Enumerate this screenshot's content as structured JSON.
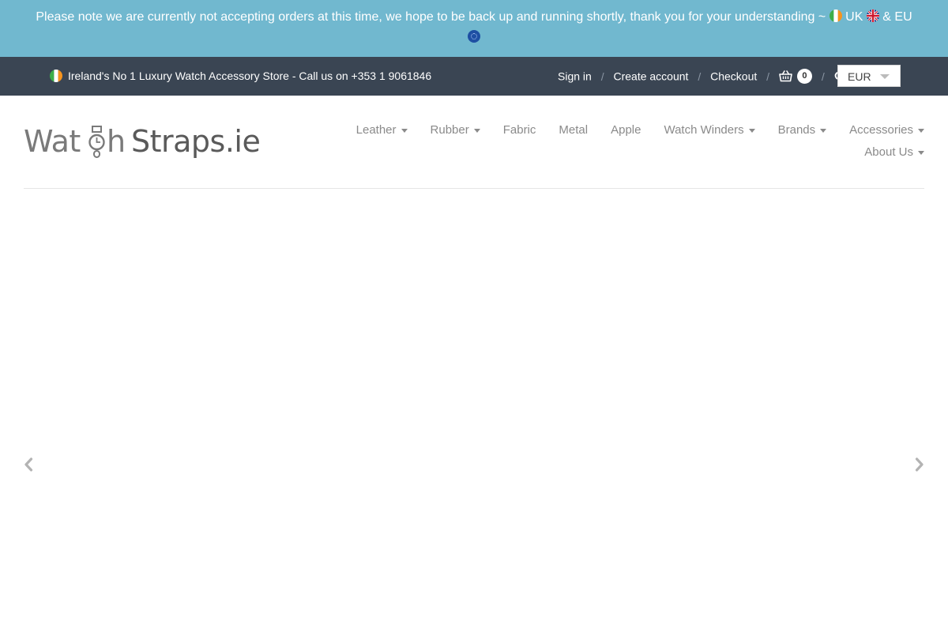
{
  "announcement": {
    "text": "Please note we are currently not accepting orders at this time, we hope to be back up and running shortly, thank you for your understanding ~",
    "uk": "UK",
    "eu": "& EU",
    "ireland_flag_icon": "ireland-flag-icon",
    "uk_flag_icon": "uk-flag-icon"
  },
  "topbar": {
    "tagline": "Ireland's No 1 Luxury Watch Accessory Store - Call us on +353 1 9061846",
    "sign_in": "Sign in",
    "create_account": "Create account",
    "checkout": "Checkout",
    "separator": "/",
    "cart_count": "0",
    "currency": "EUR"
  },
  "header": {
    "logo_text": "WatchStraps.ie"
  },
  "nav": {
    "items": [
      {
        "label": "Leather",
        "has_dropdown": true
      },
      {
        "label": "Rubber",
        "has_dropdown": true
      },
      {
        "label": "Fabric",
        "has_dropdown": false
      },
      {
        "label": "Metal",
        "has_dropdown": false
      },
      {
        "label": "Apple",
        "has_dropdown": false
      },
      {
        "label": "Watch Winders",
        "has_dropdown": true
      },
      {
        "label": "Brands",
        "has_dropdown": true
      },
      {
        "label": "Accessories",
        "has_dropdown": true
      }
    ],
    "row2": [
      {
        "label": "About Us",
        "has_dropdown": true
      }
    ]
  },
  "colors": {
    "banner_bg": "#71b8cf",
    "topbar_bg": "#3a4553",
    "nav_text": "#8a8a8a"
  }
}
